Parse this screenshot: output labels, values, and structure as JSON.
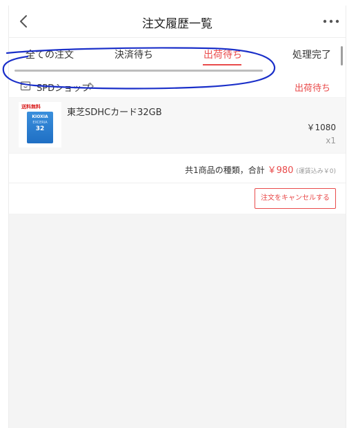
{
  "header": {
    "title": "注文履歴一覧"
  },
  "tabs": [
    {
      "label": "全ての注文"
    },
    {
      "label": "決済待ち"
    },
    {
      "label": "出荷待ち"
    },
    {
      "label": "処理完了"
    }
  ],
  "active_tab": "出荷待ち",
  "order": {
    "shop_name": "SPDショップ",
    "status": "出荷待ち",
    "item": {
      "name": "東芝SDHCカード32GB",
      "price": "￥1080",
      "quantity": "x1",
      "thumbnail": {
        "badge": "送料無料",
        "brand": "KIOXIA",
        "line": "EXCERIA",
        "capacity": "32"
      }
    },
    "summary": {
      "prefix": "共1商品の種類，合計",
      "total": "￥980",
      "shipping": "(運賃込み￥0)"
    },
    "cancel_label": "注文をキャンセルする"
  },
  "colors": {
    "accent": "#e94a4a",
    "annotation": "#1a2fc9"
  }
}
